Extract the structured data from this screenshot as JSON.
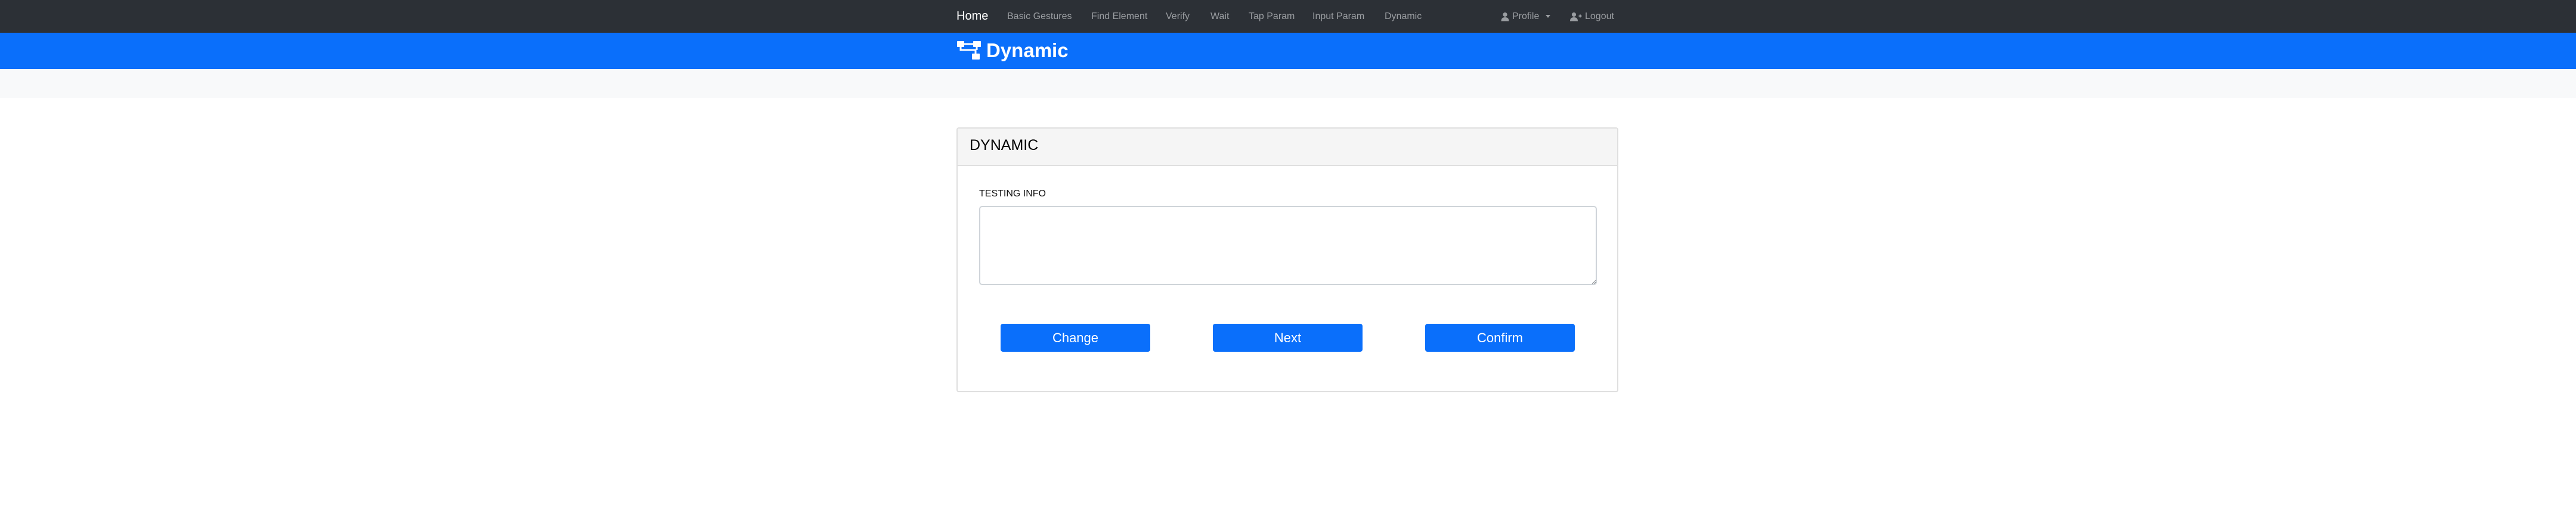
{
  "nav": {
    "items": [
      {
        "label": "Home",
        "active": true
      },
      {
        "label": "Basic Gestures"
      },
      {
        "label": "Find Element"
      },
      {
        "label": "Verify"
      },
      {
        "label": "Wait"
      },
      {
        "label": "Tap Param"
      },
      {
        "label": "Input Param"
      },
      {
        "label": "Dynamic"
      }
    ],
    "profile": {
      "label": "Profile",
      "icon": "user-icon"
    },
    "logout": {
      "label": "Logout",
      "icon": "user-plus-icon"
    }
  },
  "brand": {
    "title": "Dynamic",
    "icon": "sitemap-icon"
  },
  "card": {
    "title": "DYNAMIC",
    "field_label": "TESTING INFO",
    "textarea_value": "",
    "buttons": {
      "change": "Change",
      "next": "Next",
      "confirm": "Confirm"
    }
  },
  "colors": {
    "navbar": "#2c3036",
    "brand_bar": "#0a6ffb",
    "button": "#0a6ffb",
    "strip": "#f8f9fa"
  }
}
